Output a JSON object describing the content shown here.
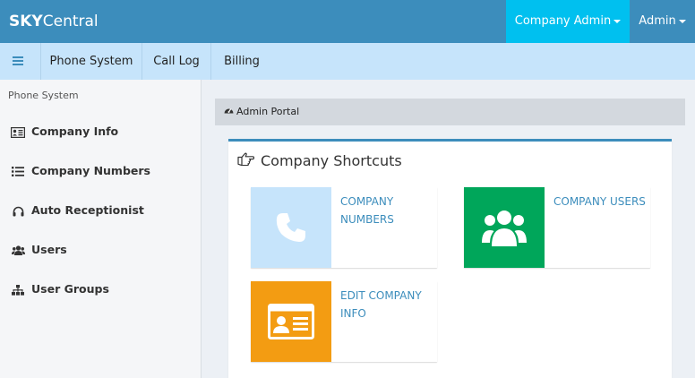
{
  "header": {
    "brand_bold": "SKY",
    "brand_rest": "Central",
    "company_menu": "Company Admin",
    "admin_menu": "Admin"
  },
  "subnav": {
    "items": [
      {
        "label": "Phone System"
      },
      {
        "label": "Call Log"
      },
      {
        "label": "Billing"
      }
    ]
  },
  "sidebar": {
    "header": "Phone System",
    "items": [
      {
        "label": "Company Info",
        "icon": "id-card-icon"
      },
      {
        "label": "Company Numbers",
        "icon": "list-icon"
      },
      {
        "label": "Auto Receptionist",
        "icon": "headphones-icon"
      },
      {
        "label": "Users",
        "icon": "users-icon"
      },
      {
        "label": "User Groups",
        "icon": "sitemap-icon"
      }
    ]
  },
  "breadcrumb": {
    "label": "Admin Portal",
    "icon": "dashboard-icon"
  },
  "shortcuts": {
    "title": "Company Shortcuts",
    "tiles": [
      {
        "label": "Company Numbers",
        "icon": "phone-icon",
        "color": "#c6e4fb"
      },
      {
        "label": "Company Users",
        "icon": "users-icon",
        "color": "#00a65a"
      },
      {
        "label": "Edit Company Info",
        "icon": "id-card-icon",
        "color": "#f39c12"
      }
    ]
  },
  "colors": {
    "header": "#3c8dbc",
    "company_menu_bg": "#00c0ef",
    "subnav_bg": "#c6e4fb",
    "link": "#3c8dbc"
  }
}
